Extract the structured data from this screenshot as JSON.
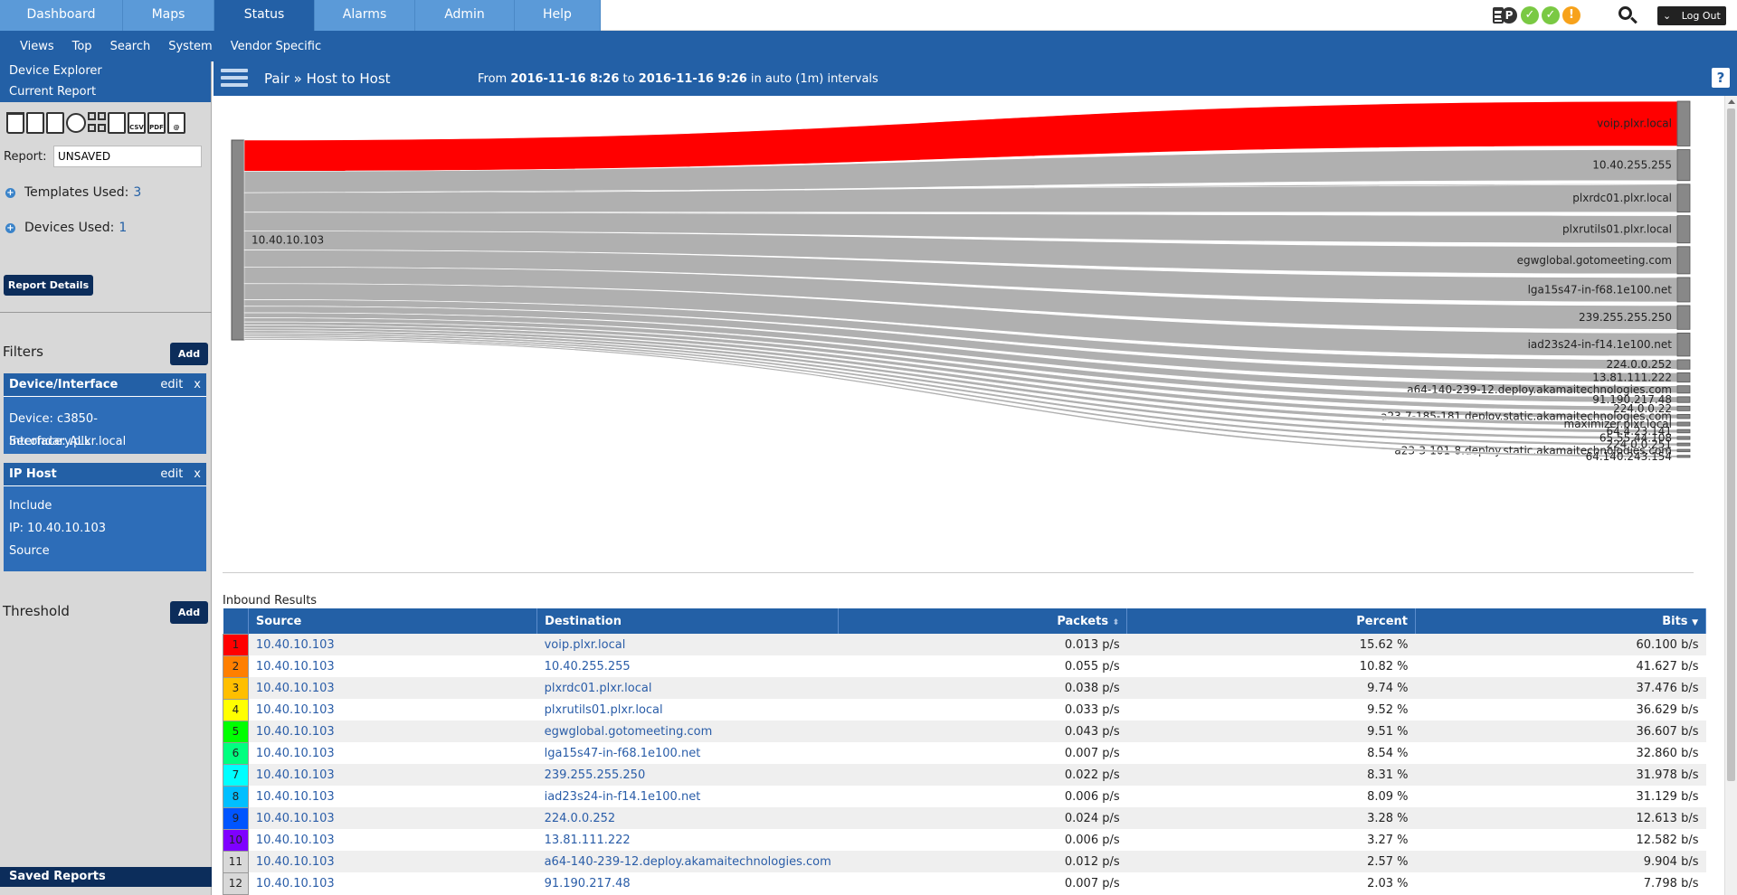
{
  "nav": {
    "tabs": [
      {
        "label": "Dashboard",
        "active": false
      },
      {
        "label": "Maps",
        "active": false
      },
      {
        "label": "Status",
        "active": true
      },
      {
        "label": "Alarms",
        "active": false
      },
      {
        "label": "Admin",
        "active": false
      },
      {
        "label": "Help",
        "active": false
      }
    ],
    "status_p_label": "P",
    "status_ok_glyph": "✓",
    "status_warn_glyph": "!",
    "logout_label": "Log Out",
    "logout_chevron": "⌄"
  },
  "subnav": {
    "items": [
      "Views",
      "Top",
      "Search",
      "System",
      "Vendor Specific"
    ]
  },
  "sidebar": {
    "device_explorer": "Device Explorer",
    "current_report": "Current Report",
    "toolbar_doc_labels": {
      "csv": "CSV",
      "pdf": "PDF",
      "email": "@"
    },
    "report_label": "Report:",
    "report_value": "UNSAVED",
    "templates_label": "Templates Used:",
    "templates_count": "3",
    "devices_label": "Devices Used:",
    "devices_count": "1",
    "report_details_button": "Report Details",
    "filters_label": "Filters",
    "add_label": "Add",
    "filter_cards": [
      {
        "title": "Device/Interface",
        "edit": "edit",
        "remove": "x",
        "lines": [
          "Device: c3850-Secondary.plxr.local",
          "Interface: ALL"
        ]
      },
      {
        "title": "IP Host",
        "edit": "edit",
        "remove": "x",
        "lines": [
          "Include",
          "IP: 10.40.10.103",
          "Source"
        ]
      }
    ],
    "threshold_label": "Threshold",
    "saved_reports": "Saved Reports"
  },
  "header": {
    "breadcrumb": "Pair » Host to Host",
    "from_label": "From",
    "from": "2016-11-16 8:26",
    "to_label": "to",
    "to": "2016-11-16 9:26",
    "interval": "in auto (1m) intervals",
    "help_label": "?"
  },
  "sankey": {
    "source": "10.40.10.103",
    "highlight_color": "#ff0000",
    "flow_color": "#b0b0b0",
    "targets": [
      {
        "name": "voip.plxr.local",
        "value": 60.1
      },
      {
        "name": "10.40.255.255",
        "value": 41.627
      },
      {
        "name": "plxrdc01.plxr.local",
        "value": 37.476
      },
      {
        "name": "plxrutils01.plxr.local",
        "value": 36.629
      },
      {
        "name": "egwglobal.gotomeeting.com",
        "value": 36.607
      },
      {
        "name": "lga15s47-in-f68.1e100.net",
        "value": 32.86
      },
      {
        "name": "239.255.255.250",
        "value": 31.978
      },
      {
        "name": "iad23s24-in-f14.1e100.net",
        "value": 31.129
      },
      {
        "name": "224.0.0.252",
        "value": 12.613
      },
      {
        "name": "13.81.111.222",
        "value": 12.582
      },
      {
        "name": "a64-140-239-12.deploy.akamaitechnologies.com",
        "value": 9.904
      },
      {
        "name": "91.190.217.48",
        "value": 7.798
      },
      {
        "name": "224.0.0.22",
        "value": 6.2
      },
      {
        "name": "a23-7-185-181.deploy.static.akamaitechnologies.com",
        "value": 5.6
      },
      {
        "name": "maximizer.plxr.local",
        "value": 5.0
      },
      {
        "name": "64.4.23.141",
        "value": 4.5
      },
      {
        "name": "65.55.44.108",
        "value": 4.0
      },
      {
        "name": "224.0.0.251",
        "value": 3.6
      },
      {
        "name": "a23-3-101-8.deploy.static.akamaitechnologies.com",
        "value": 3.2
      },
      {
        "name": "64.140.243.154",
        "value": 2.8
      }
    ]
  },
  "results": {
    "title": "Inbound Results",
    "columns": {
      "source": "Source",
      "destination": "Destination",
      "packets": "Packets",
      "percent": "Percent",
      "bits": "Bits"
    },
    "packets_sort_icon": "⬍",
    "bits_sort_icon": "▼",
    "rows": [
      {
        "rank": "1",
        "color": "#ff0000",
        "source": "10.40.10.103",
        "destination": "voip.plxr.local",
        "packets": "0.013 p/s",
        "percent": "15.62 %",
        "bits": "60.100 b/s"
      },
      {
        "rank": "2",
        "color": "#ff7f00",
        "source": "10.40.10.103",
        "destination": "10.40.255.255",
        "packets": "0.055 p/s",
        "percent": "10.82 %",
        "bits": "41.627 b/s"
      },
      {
        "rank": "3",
        "color": "#ffbf00",
        "source": "10.40.10.103",
        "destination": "plxrdc01.plxr.local",
        "packets": "0.038 p/s",
        "percent": "9.74 %",
        "bits": "37.476 b/s"
      },
      {
        "rank": "4",
        "color": "#ffff00",
        "source": "10.40.10.103",
        "destination": "plxrutils01.plxr.local",
        "packets": "0.033 p/s",
        "percent": "9.52 %",
        "bits": "36.629 b/s"
      },
      {
        "rank": "5",
        "color": "#00ff00",
        "source": "10.40.10.103",
        "destination": "egwglobal.gotomeeting.com",
        "packets": "0.043 p/s",
        "percent": "9.51 %",
        "bits": "36.607 b/s"
      },
      {
        "rank": "6",
        "color": "#00ff7f",
        "source": "10.40.10.103",
        "destination": "lga15s47-in-f68.1e100.net",
        "packets": "0.007 p/s",
        "percent": "8.54 %",
        "bits": "32.860 b/s"
      },
      {
        "rank": "7",
        "color": "#00ffff",
        "source": "10.40.10.103",
        "destination": "239.255.255.250",
        "packets": "0.022 p/s",
        "percent": "8.31 %",
        "bits": "31.978 b/s"
      },
      {
        "rank": "8",
        "color": "#00bfff",
        "source": "10.40.10.103",
        "destination": "iad23s24-in-f14.1e100.net",
        "packets": "0.006 p/s",
        "percent": "8.09 %",
        "bits": "31.129 b/s"
      },
      {
        "rank": "9",
        "color": "#0055ff",
        "source": "10.40.10.103",
        "destination": "224.0.0.252",
        "packets": "0.024 p/s",
        "percent": "3.28 %",
        "bits": "12.613 b/s"
      },
      {
        "rank": "10",
        "color": "#7f00ff",
        "source": "10.40.10.103",
        "destination": "13.81.111.222",
        "packets": "0.006 p/s",
        "percent": "3.27 %",
        "bits": "12.582 b/s"
      },
      {
        "rank": "11",
        "color": "#d8d8d8",
        "source": "10.40.10.103",
        "destination": "a64-140-239-12.deploy.akamaitechnologies.com",
        "packets": "0.012 p/s",
        "percent": "2.57 %",
        "bits": "9.904 b/s"
      },
      {
        "rank": "12",
        "color": "#d8d8d8",
        "source": "10.40.10.103",
        "destination": "91.190.217.48",
        "packets": "0.007 p/s",
        "percent": "2.03 %",
        "bits": "7.798 b/s"
      }
    ]
  }
}
